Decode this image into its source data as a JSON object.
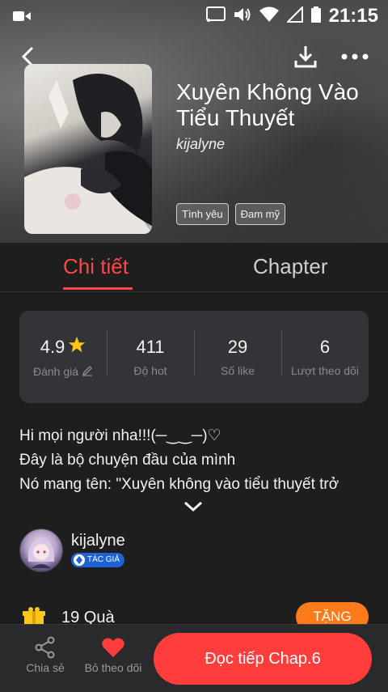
{
  "status_bar": {
    "time": "21:15"
  },
  "book": {
    "title": "Xuyên Không Vào Tiểu Thuyết",
    "author": "kijalyne",
    "tags": [
      "Tình yêu",
      "Đam mỹ"
    ]
  },
  "tabs": {
    "detail": "Chi tiết",
    "chapter": "Chapter"
  },
  "stats": [
    {
      "value": "4.9",
      "label": "Đánh giá"
    },
    {
      "value": "411",
      "label": "Độ hot"
    },
    {
      "value": "29",
      "label": "Số like"
    },
    {
      "value": "6",
      "label": "Lượt theo dõi"
    }
  ],
  "description": [
    "Hi mọi người nha!!!(─‿‿─)♡",
    "Đây là bộ chuyện đầu của mình",
    "Nó mang tên: \"Xuyên không vào tiểu thuyết trở"
  ],
  "author_section": {
    "name": "kijalyne",
    "badge": "TÁC GIẢ"
  },
  "gifts": {
    "count_text": "19 Quà",
    "give_label": "TẶNG"
  },
  "bottom_bar": {
    "share_label": "Chia sẻ",
    "unfollow_label": "Bỏ theo dõi",
    "read_label": "Đọc tiếp Chap.6"
  },
  "colors": {
    "accent": "#ff4747",
    "read_button": "#ff3d3d",
    "give_button": "#ff7a1a",
    "badge": "#1e63d6"
  }
}
